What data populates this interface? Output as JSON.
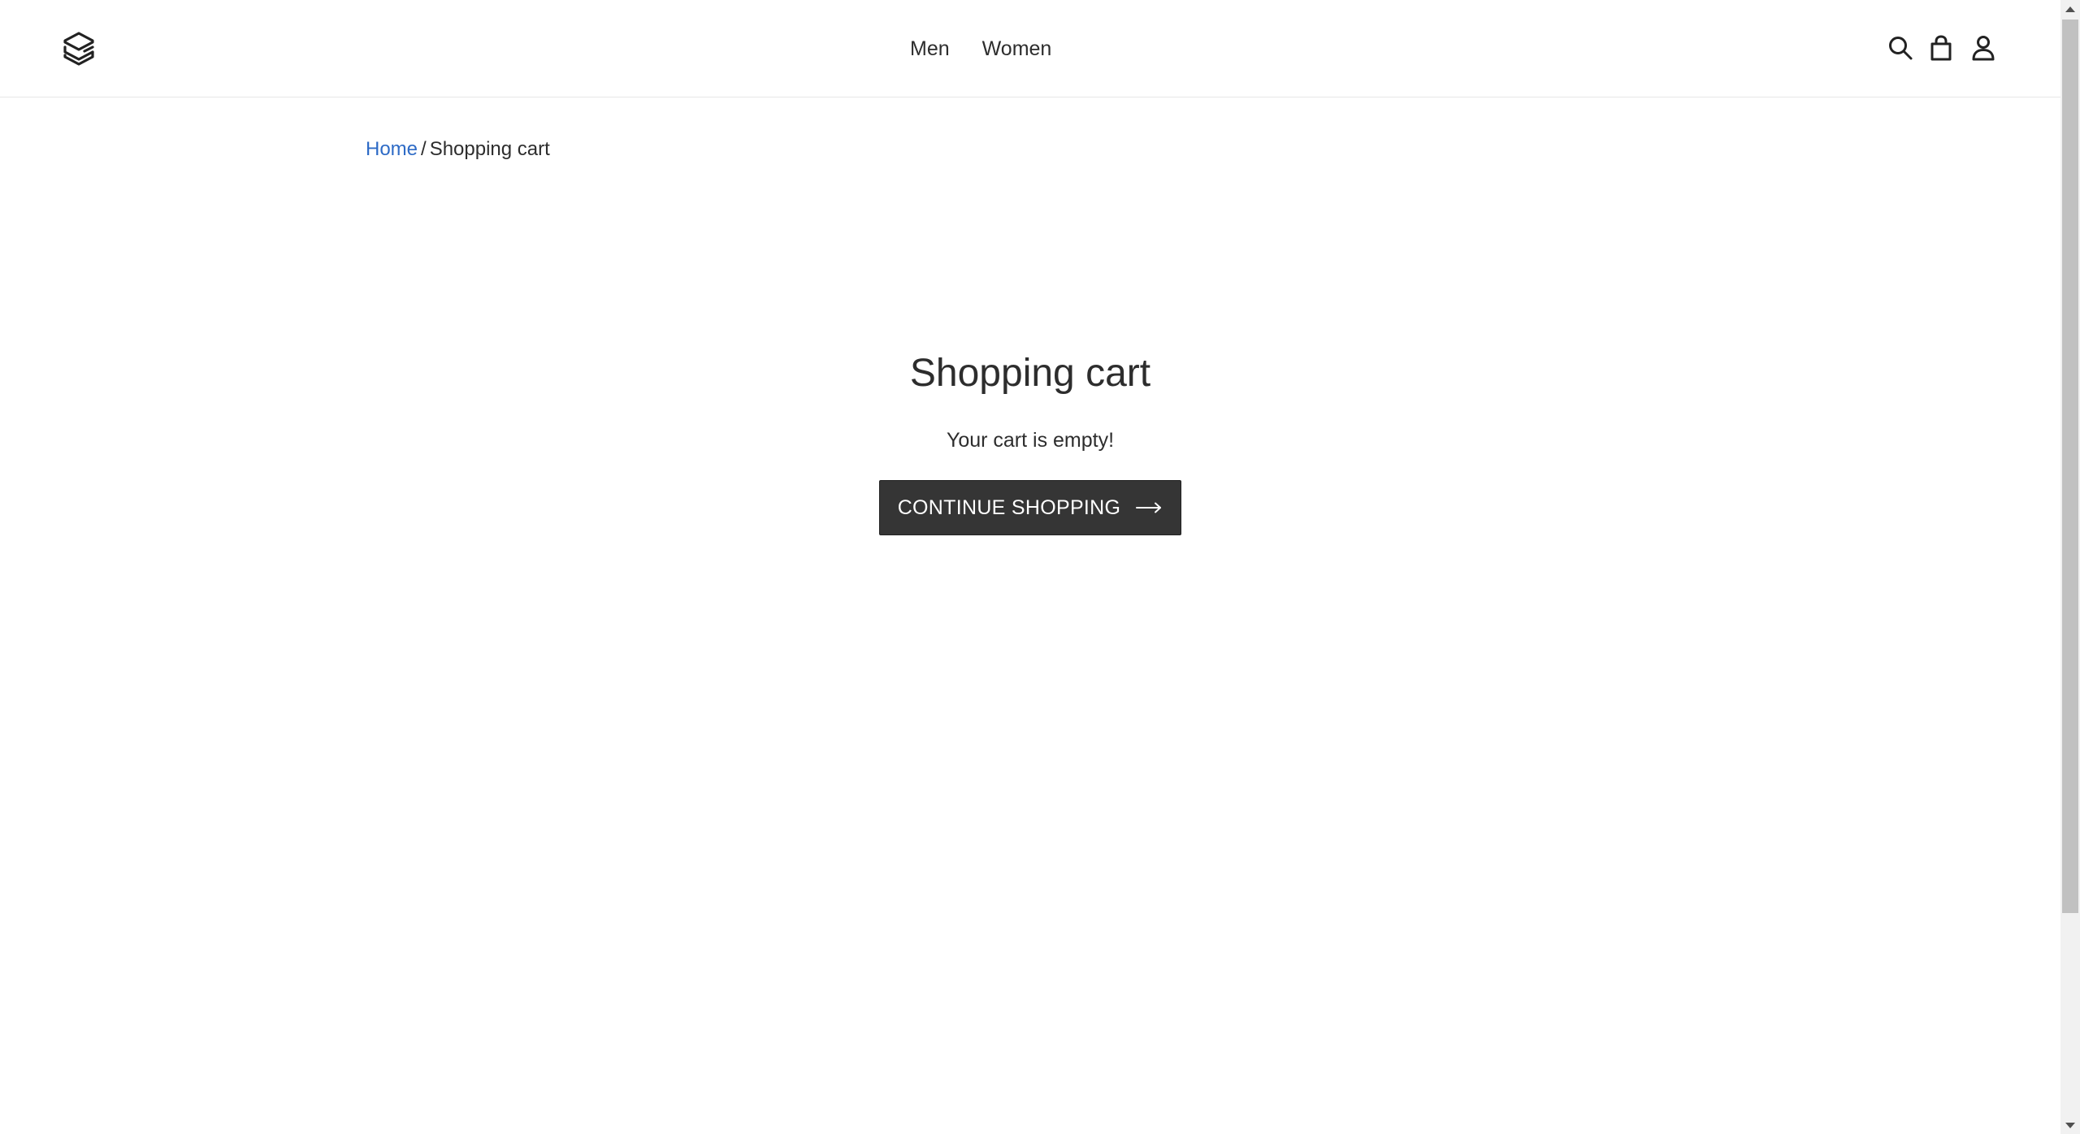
{
  "header": {
    "logo_icon": "layered-stack-logo-icon",
    "nav": [
      {
        "label": "Men"
      },
      {
        "label": "Women"
      }
    ],
    "icons": {
      "search": "search-icon",
      "cart": "shopping-bag-icon",
      "account": "user-icon"
    }
  },
  "breadcrumb": {
    "home": "Home",
    "separator": "/",
    "current": "Shopping cart"
  },
  "cart": {
    "title": "Shopping cart",
    "empty_message": "Your cart is empty!",
    "continue_label": "CONTINUE SHOPPING",
    "continue_icon": "arrow-right-icon"
  },
  "colors": {
    "link": "#2e6bc6",
    "button_bg": "#353535",
    "text": "#2d2d2d"
  }
}
